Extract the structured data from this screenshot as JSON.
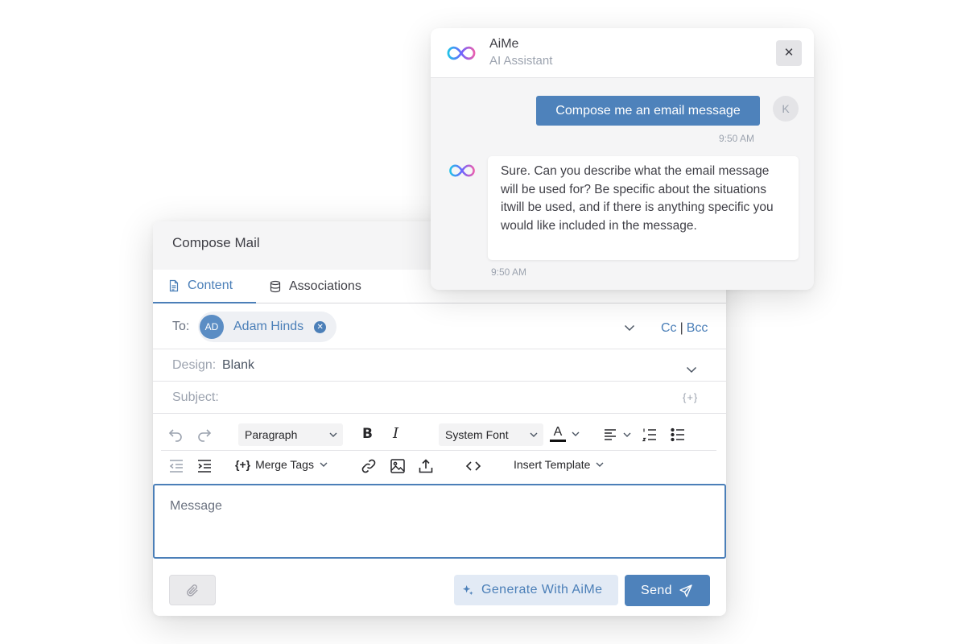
{
  "compose": {
    "title": "Compose Mail",
    "tabs": [
      {
        "label": "Content",
        "icon": "document-icon",
        "active": true
      },
      {
        "label": "Associations",
        "icon": "database-icon",
        "active": false
      }
    ],
    "to": {
      "label": "To:",
      "recipient_initials": "AD",
      "recipient_name": "Adam Hinds",
      "cc": "Cc",
      "separator": "|",
      "bcc": "Bcc"
    },
    "design": {
      "label": "Design:",
      "value": "Blank"
    },
    "subject": {
      "label": "Subject:",
      "value": "",
      "merge_symbol": "{+}"
    },
    "toolbar": {
      "paragraph": "Paragraph",
      "bold": "B",
      "italic": "I",
      "font": "System Font",
      "text_color_glyph": "A",
      "merge_tags": "Merge Tags",
      "insert_template": "Insert Template"
    },
    "message_placeholder": "Message",
    "generate_label": "Generate With AiMe",
    "send_label": "Send"
  },
  "chat": {
    "name": "AiMe",
    "subtitle": "AI Assistant",
    "close_glyph": "✕",
    "user_message": "Compose me an email message",
    "user_initial": "K",
    "user_time": "9:50 AM",
    "bot_message": "Sure. Can you describe what the email message will be used for? Be specific about the situations itwill be used, and if there is anything specific you would like included in the message.",
    "bot_time": "9:50 AM"
  },
  "colors": {
    "accent": "#4b7fb8",
    "send_button": "#4e82bb",
    "generate_bg": "#e2eaf5",
    "panel_header_bg": "#f5f5f6"
  }
}
